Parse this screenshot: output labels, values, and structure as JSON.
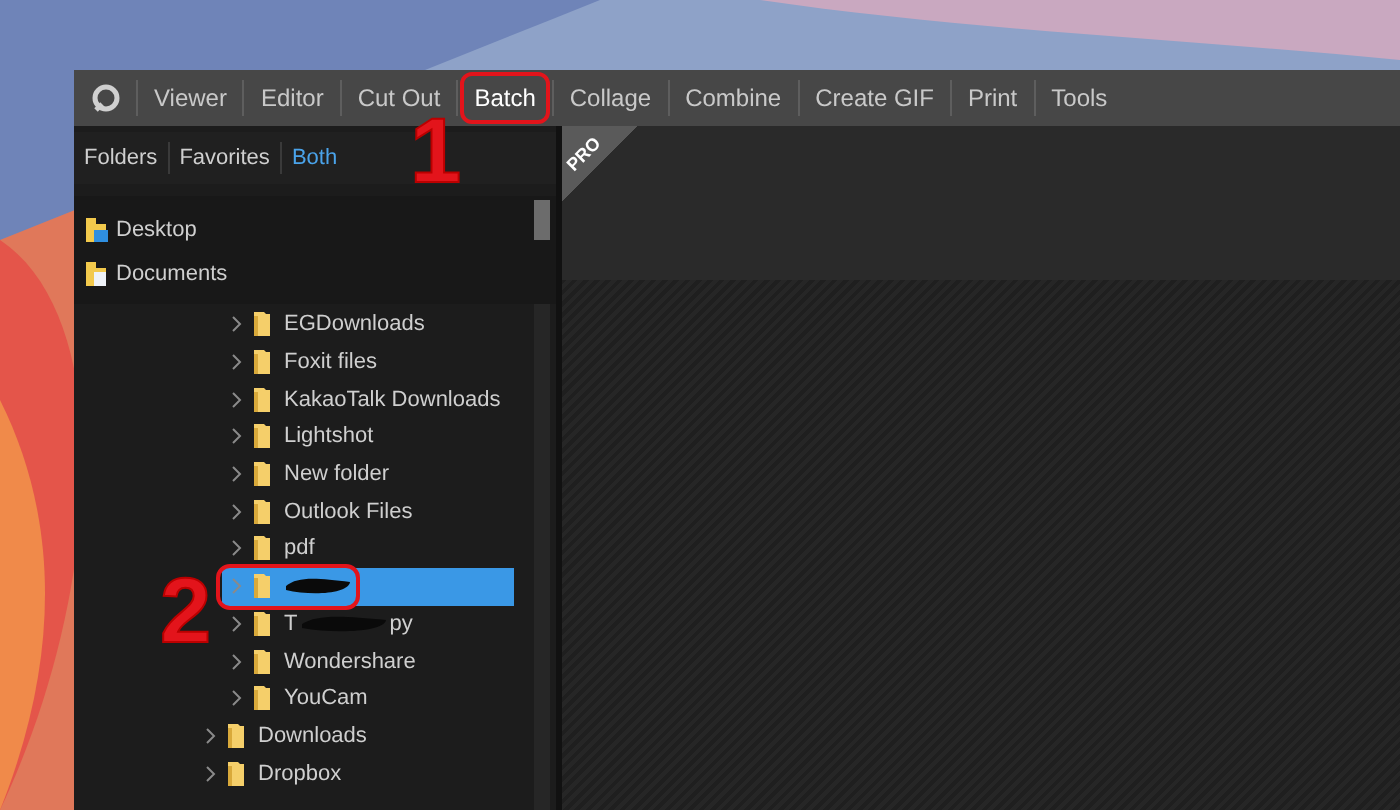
{
  "menu": {
    "tabs": [
      {
        "label": "Viewer",
        "selected": false,
        "highlighted": false
      },
      {
        "label": "Editor",
        "selected": false,
        "highlighted": false
      },
      {
        "label": "Cut Out",
        "selected": false,
        "highlighted": false
      },
      {
        "label": "Batch",
        "selected": true,
        "highlighted": true
      },
      {
        "label": "Collage",
        "selected": false,
        "highlighted": false
      },
      {
        "label": "Combine",
        "selected": false,
        "highlighted": false
      },
      {
        "label": "Create GIF",
        "selected": false,
        "highlighted": false
      },
      {
        "label": "Print",
        "selected": false,
        "highlighted": false
      },
      {
        "label": "Tools",
        "selected": false,
        "highlighted": false
      }
    ]
  },
  "folder_panel": {
    "tabs": [
      {
        "label": "Folders",
        "selected": false
      },
      {
        "label": "Favorites",
        "selected": false
      },
      {
        "label": "Both",
        "selected": true
      }
    ],
    "pinned": [
      {
        "label": "Desktop",
        "kind": "desktop"
      },
      {
        "label": "Documents",
        "kind": "documents"
      }
    ],
    "tree": [
      {
        "children": [
          {
            "label": "EGDownloads",
            "selected": false,
            "highlighted": false
          },
          {
            "label": "Foxit files",
            "selected": false,
            "highlighted": false
          },
          {
            "label": "KakaoTalk Downloads",
            "selected": false,
            "highlighted": false
          },
          {
            "label": "Lightshot",
            "selected": false,
            "highlighted": false
          },
          {
            "label": "New folder",
            "selected": false,
            "highlighted": false
          },
          {
            "label": "Outlook Files",
            "selected": false,
            "highlighted": false
          },
          {
            "label": "pdf",
            "selected": false,
            "highlighted": false
          },
          {
            "redacted": true,
            "selected": true,
            "highlighted": true
          },
          {
            "label_start": "T",
            "label_end": "py",
            "redacted": true,
            "selected": false,
            "highlighted": false
          },
          {
            "label": "Wondershare",
            "selected": false,
            "highlighted": false
          },
          {
            "label": "YouCam",
            "selected": false,
            "highlighted": false
          }
        ]
      },
      {
        "label": "Downloads",
        "selected": false,
        "highlighted": false
      },
      {
        "label": "Dropbox",
        "selected": false,
        "highlighted": false
      }
    ]
  },
  "view": {
    "badge": "PRO"
  },
  "annotations": [
    {
      "number": "1"
    },
    {
      "number": "2"
    }
  ]
}
